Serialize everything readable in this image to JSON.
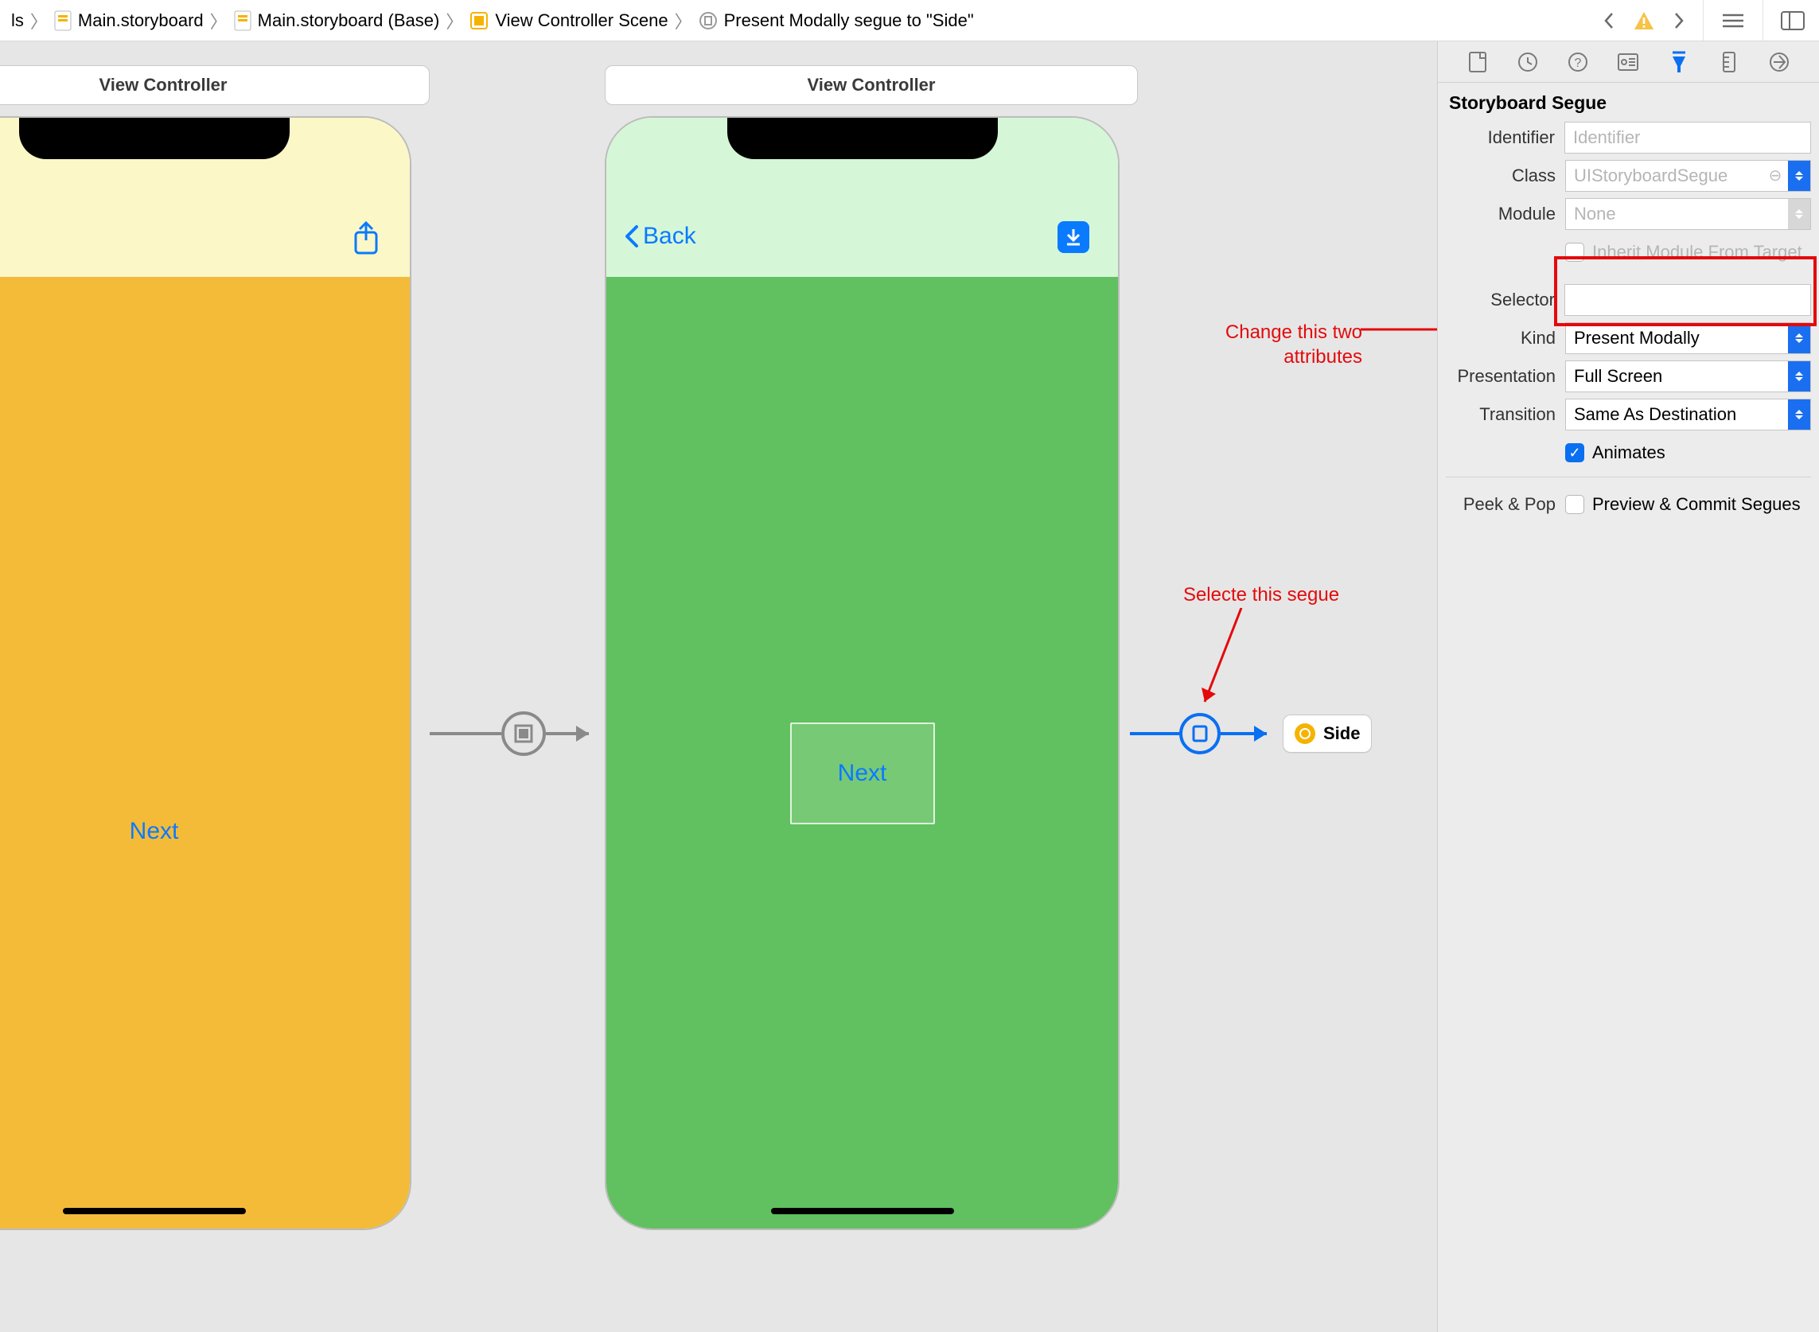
{
  "breadcrumbs": {
    "c0": "ls",
    "c1": "Main.storyboard",
    "c2": "Main.storyboard (Base)",
    "c3": "View Controller Scene",
    "c4": "Present Modally segue to \"Side\""
  },
  "canvas": {
    "scene1_title": "View Controller",
    "scene2_title": "View Controller",
    "next_label": "Next",
    "back_label": "Back",
    "side_label": "Side"
  },
  "annotations": {
    "attr_note": "Change this two attributes",
    "segue_note": "Selecte this segue"
  },
  "inspector": {
    "section": "Storyboard Segue",
    "identifier_label": "Identifier",
    "identifier_placeholder": "Identifier",
    "class_label": "Class",
    "class_value": "UIStoryboardSegue",
    "module_label": "Module",
    "module_value": "None",
    "inherit_label": "Inherit Module From Target",
    "selector_label": "Selector",
    "selector_value": "",
    "kind_label": "Kind",
    "kind_value": "Present Modally",
    "presentation_label": "Presentation",
    "presentation_value": "Full Screen",
    "transition_label": "Transition",
    "transition_value": "Same As Destination",
    "animates_label": "Animates",
    "peek_label": "Peek & Pop",
    "peek_option": "Preview & Commit Segues"
  }
}
